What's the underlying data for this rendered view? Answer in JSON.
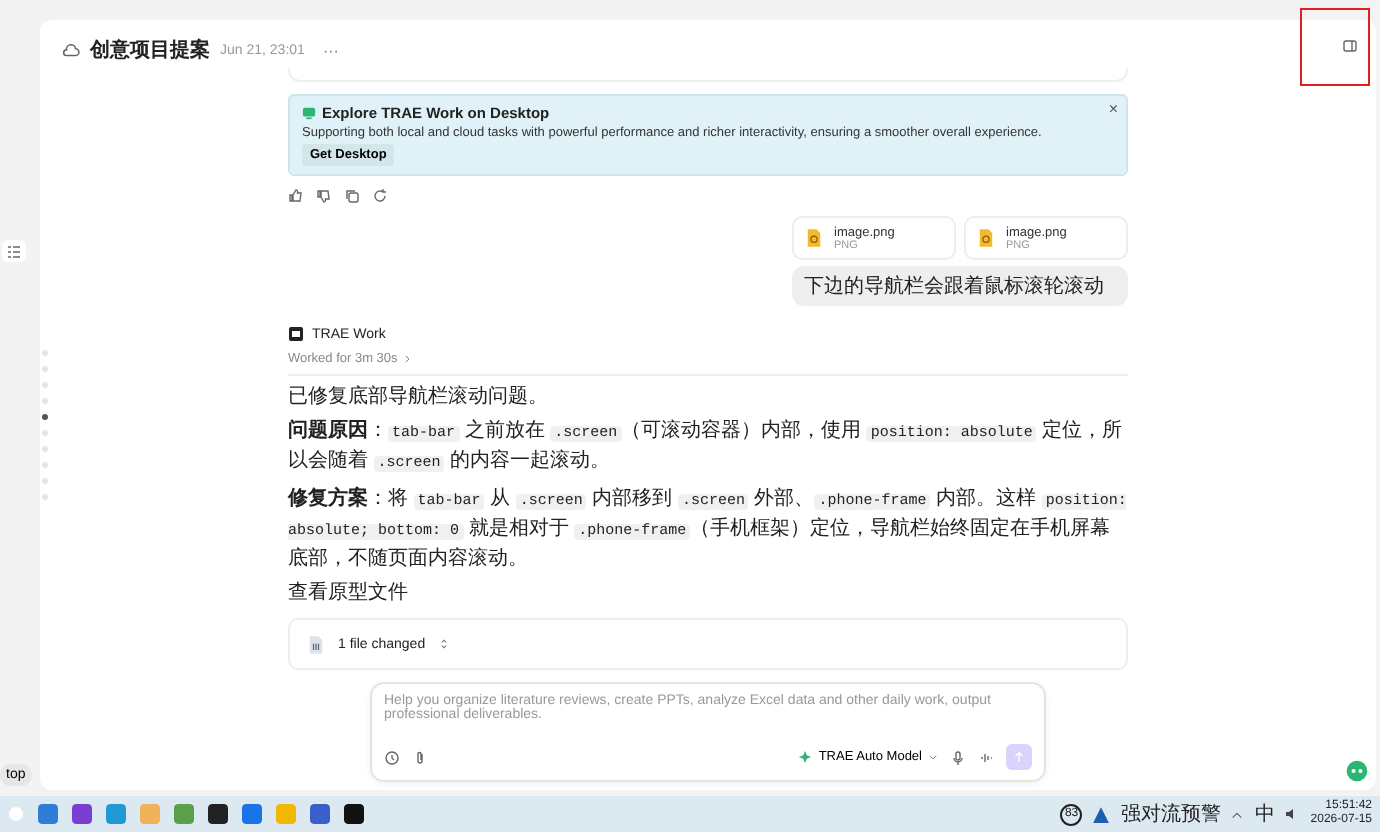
{
  "header": {
    "title": "创意项目提案",
    "date": "Jun 21, 23:01",
    "menu": "···"
  },
  "banner": {
    "title": "Explore TRAE Work on Desktop",
    "text": "Supporting both local and cloud tasks with powerful performance and richer interactivity, ensuring a smoother overall experience.",
    "button": "Get Desktop",
    "close": "×"
  },
  "attachments": [
    {
      "name": "image.png",
      "type": "PNG"
    },
    {
      "name": "image.png",
      "type": "PNG"
    }
  ],
  "user_message": "下边的导航栏会跟着鼠标滚轮滚动",
  "agent": {
    "name": "TRAE Work",
    "worked": "Worked for 3m 30s",
    "paragraphs": [
      {
        "segments": [
          {
            "kind": "text",
            "text": "已修复底部导航栏滚动问题。"
          }
        ]
      },
      {
        "segments": [
          {
            "kind": "bold",
            "text": "问题原因"
          },
          {
            "kind": "text",
            "text": "："
          },
          {
            "kind": "code",
            "text": "tab-bar"
          },
          {
            "kind": "text",
            "text": " 之前放在 "
          },
          {
            "kind": "code",
            "text": ".screen"
          },
          {
            "kind": "text",
            "text": "（可滚动容器）内部，使用 "
          },
          {
            "kind": "code",
            "text": "position: absolute"
          },
          {
            "kind": "text",
            "text": " 定位，所以会随着 "
          },
          {
            "kind": "code",
            "text": ".screen"
          },
          {
            "kind": "text",
            "text": " 的内容一起滚动。"
          }
        ]
      },
      {
        "segments": [
          {
            "kind": "bold",
            "text": "修复方案"
          },
          {
            "kind": "text",
            "text": "：将 "
          },
          {
            "kind": "code",
            "text": "tab-bar"
          },
          {
            "kind": "text",
            "text": " 从 "
          },
          {
            "kind": "code",
            "text": ".screen"
          },
          {
            "kind": "text",
            "text": " 内部移到 "
          },
          {
            "kind": "code",
            "text": ".screen"
          },
          {
            "kind": "text",
            "text": " 外部、"
          },
          {
            "kind": "code",
            "text": ".phone-frame"
          },
          {
            "kind": "text",
            "text": " 内部。这样 "
          },
          {
            "kind": "code",
            "text": "position: absolute; bottom: 0"
          },
          {
            "kind": "text",
            "text": " 就是相对于 "
          },
          {
            "kind": "code",
            "text": ".phone-frame"
          },
          {
            "kind": "text",
            "text": "（手机框架）定位，导航栏始终固定在手机屏幕底部，不随页面内容滚动。"
          }
        ]
      },
      {
        "segments": [
          {
            "kind": "text",
            "text": "查看原型文件"
          }
        ]
      }
    ],
    "file_card": {
      "label": "1 file changed"
    }
  },
  "input": {
    "placeholder": "Help you organize literature reviews, create PPTs, analyze Excel data and other daily work, output professional deliverables.",
    "model": "TRAE Auto Model"
  },
  "scroll_dots": [
    {
      "selected": false
    },
    {
      "selected": false
    },
    {
      "selected": false
    },
    {
      "selected": false
    },
    {
      "selected": true
    },
    {
      "selected": false
    },
    {
      "selected": false
    },
    {
      "selected": false
    },
    {
      "selected": false
    },
    {
      "selected": false
    }
  ],
  "side_button": "top",
  "taskbar": {
    "badge": "83",
    "alert": "强对流预警",
    "ime": "中",
    "time": "15:51:42",
    "date": "2026-07-15"
  }
}
